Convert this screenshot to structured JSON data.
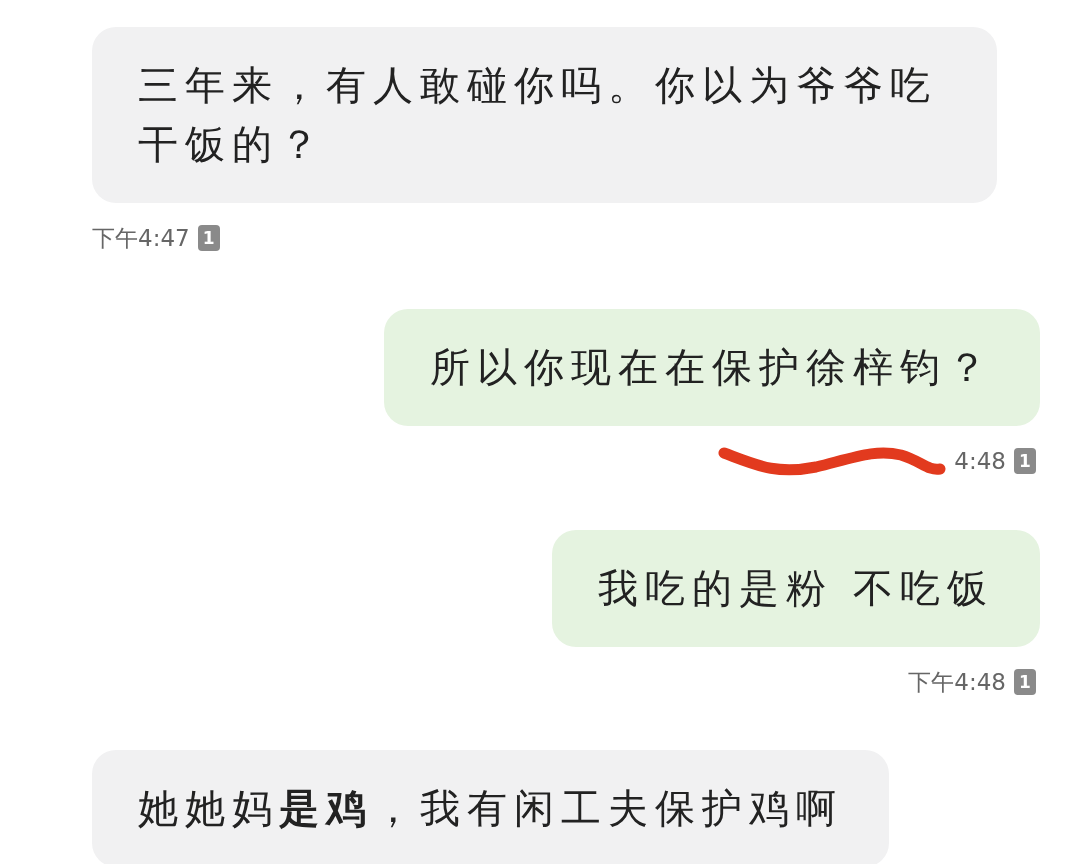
{
  "messages": [
    {
      "kind": "incoming",
      "text": "三年来，有人敢碰你吗。你以为爷爷吃干饭的？",
      "time": "下午4:47",
      "read": "1",
      "scribbled": false
    },
    {
      "kind": "outgoing",
      "text": "所以你现在在保护徐梓钧？",
      "time": "4:48",
      "read": "1",
      "scribbled": true
    },
    {
      "kind": "outgoing",
      "text": "我吃的是粉 不吃饭",
      "time": "下午4:48",
      "read": "1",
      "scribbled": false
    },
    {
      "kind": "incoming",
      "text": "她她妈**是鸡**，我有闲工夫保护鸡啊"
    }
  ]
}
